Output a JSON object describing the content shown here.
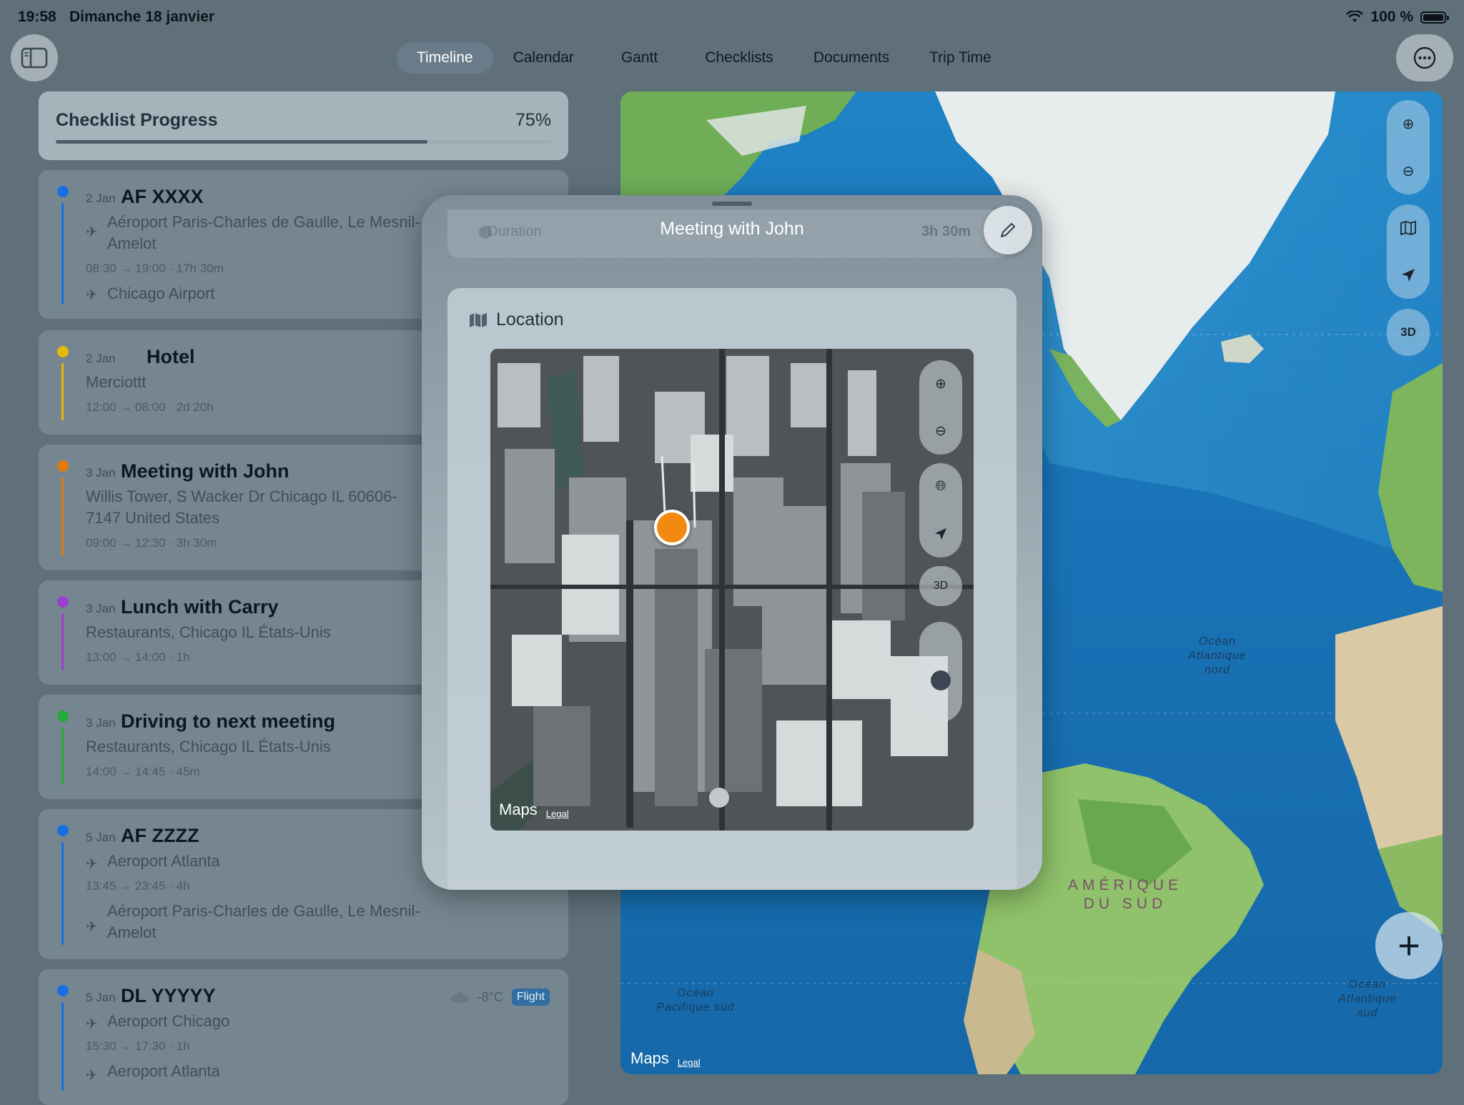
{
  "status": {
    "time": "19:58",
    "date": "Dimanche 18 janvier",
    "battery": "100 %"
  },
  "nav": {
    "tabs": [
      "Timeline",
      "Calendar",
      "Gantt",
      "Checklists",
      "Documents",
      "Trip Time"
    ],
    "active_tab": "Timeline"
  },
  "checklist": {
    "title": "Checklist Progress",
    "percent_label": "75%",
    "progress": 0.75
  },
  "events": [
    {
      "date": "2 Jan",
      "name": "AF XXXX",
      "color": "#1a6fe0",
      "type": "flight",
      "from": "Aéroport Paris-Charles de Gaulle, Le Mesnil-Amelot",
      "times": "08:30 → 19:00 · 17h 30m",
      "to": "Chicago Airport"
    },
    {
      "date": "2 Jan",
      "name": "Hotel",
      "color": "#e5b90a",
      "type": "place",
      "location": "Merciottt",
      "times": "12:00 → 08:00 · 2d 20h"
    },
    {
      "date": "3 Jan",
      "name": "Meeting with John",
      "color": "#e07b10",
      "type": "place",
      "location": "Willis Tower, S Wacker Dr Chicago IL 60606-7147 United States",
      "times": "09:00 → 12:30 · 3h 30m"
    },
    {
      "date": "3 Jan",
      "name": "Lunch with Carry",
      "color": "#9b3fcf",
      "type": "place",
      "location": "Restaurants, Chicago IL États-Unis",
      "times": "13:00 → 14:00 · 1h"
    },
    {
      "date": "3 Jan",
      "name": "Driving to next meeting",
      "color": "#25a83c",
      "type": "place",
      "location": "Restaurants, Chicago IL États-Unis",
      "times": "14:00 → 14:45 · 45m"
    },
    {
      "date": "5 Jan",
      "name": "AF ZZZZ",
      "color": "#1a6fe0",
      "type": "flight",
      "from": "Aeroport Atlanta",
      "times": "13:45 → 23:45 · 4h",
      "to": "Aéroport Paris-Charles de Gaulle, Le Mesnil-Amelot"
    },
    {
      "date": "5 Jan",
      "name": "DL YYYYY",
      "color": "#1a6fe0",
      "type": "flight",
      "from": "Aeroport Chicago",
      "times": "15:30 → 17:30 · 1h",
      "to": "Aeroport Atlanta",
      "weather": "-8°C",
      "badge": "Flight"
    }
  ],
  "sheet": {
    "title": "Meeting with John",
    "duration_label": "Duration",
    "duration_value": "3h 30m",
    "location_header": "Location",
    "maps_brand": "Maps",
    "legal": "Legal",
    "three_d": "3D"
  },
  "world_map": {
    "labels": {
      "north_atlantic": "Océan Atlantique nord",
      "south_america": "AMÉRIQUE DU SUD",
      "south_pacific": "Océan Pacifique sud",
      "south_atlantic": "Océan Atlantique sud"
    },
    "maps_brand": "Maps",
    "legal": "Legal",
    "three_d": "3D"
  },
  "icons": {
    "sidebar": "sidebar-toggle-icon",
    "more": "ellipsis-circle-icon",
    "zoom_in": "zoom-in-icon",
    "zoom_out": "zoom-out-icon",
    "map_mode": "map-icon",
    "locate": "location-arrow-icon",
    "add": "plus-icon",
    "edit": "pencil-icon",
    "globe": "globe-icon"
  }
}
